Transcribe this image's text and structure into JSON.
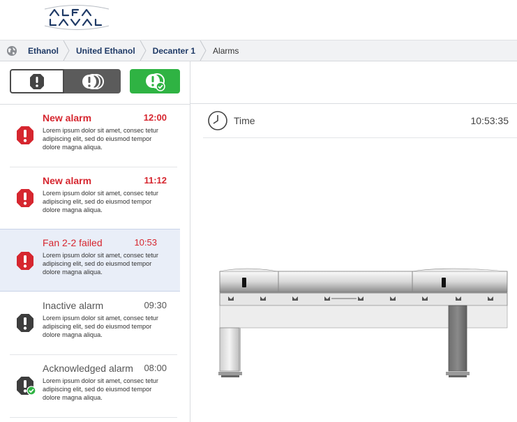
{
  "logo": {
    "text": "ALFA LAVAL",
    "name": "alfa-laval-logo"
  },
  "breadcrumb": {
    "icon": "globe-icon",
    "items": [
      "Ethanol",
      "United Ethanol",
      "Decanter 1",
      "Alarms"
    ]
  },
  "filters": [
    {
      "name": "all",
      "icon": "alarm-icon",
      "state": "outlined"
    },
    {
      "name": "inactive",
      "icon": "stacked-alarm-icon",
      "state": "dark"
    },
    {
      "name": "acknowledged",
      "icon": "acknowledged-alarm-icon",
      "state": "active-green"
    }
  ],
  "alarms": [
    {
      "title": "New alarm",
      "time": "12:00",
      "body": "Lorem ipsum dolor sit amet, consec tetur adipiscing elit, sed do eiusmod tempor dolore magna aliqua.",
      "severity": "red",
      "icon": "alarm-exclamation-icon"
    },
    {
      "title": "New alarm",
      "time": "11:12",
      "body": "Lorem ipsum dolor sit amet, consec tetur adipiscing elit, sed do eiusmod tempor dolore magna aliqua.",
      "severity": "red",
      "icon": "alarm-exclamation-icon"
    },
    {
      "title": "Fan 2-2 failed",
      "time": "10:53",
      "body": "Lorem ipsum dolor sit amet, consec tetur adipiscing elit, sed do eiusmod tempor dolore magna aliqua.",
      "severity": "red-selected",
      "icon": "alarm-exclamation-icon"
    },
    {
      "title": "Inactive alarm",
      "time": "09:30",
      "body": "Lorem ipsum dolor sit amet, consec tetur adipiscing elit, sed do eiusmod tempor dolore magna aliqua.",
      "severity": "inactive",
      "icon": "inactive-alarm-icon"
    },
    {
      "title": "Acknowledged alarm",
      "time": "08:00",
      "body": "Lorem ipsum dolor sit amet, consec tetur adipiscing elit, sed do eiusmod tempor dolore magna aliqua.",
      "severity": "acknowledged",
      "icon": "acknowledged-alarm-icon"
    }
  ],
  "detail": {
    "time_label": "Time",
    "time_value": "10:53:35",
    "clock_icon": "clock-icon",
    "image": "decanter-machine-illustration"
  },
  "colors": {
    "alarm_red": "#d6262f",
    "accent_green": "#2fb343",
    "nav_blue": "#1f3a66",
    "selected_bg": "#e9eef8"
  }
}
